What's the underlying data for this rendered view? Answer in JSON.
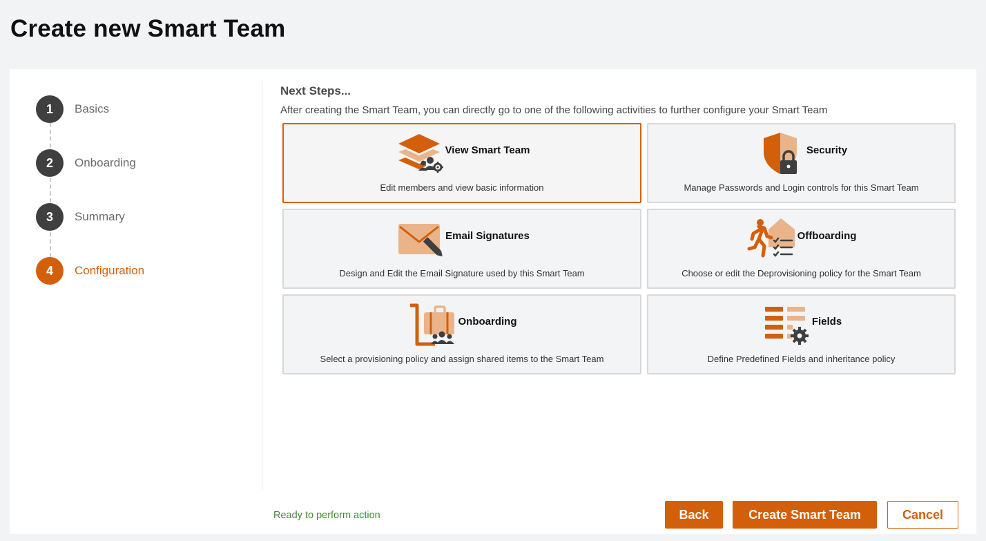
{
  "page": {
    "title": "Create new Smart Team"
  },
  "stepper": {
    "steps": [
      {
        "number": "1",
        "label": "Basics"
      },
      {
        "number": "2",
        "label": "Onboarding"
      },
      {
        "number": "3",
        "label": "Summary"
      },
      {
        "number": "4",
        "label": "Configuration",
        "active": true
      }
    ]
  },
  "next_steps": {
    "title": "Next Steps...",
    "description": "After creating the Smart Team, you can directly go to one of the following activities to further configure your Smart Team",
    "tiles": [
      {
        "title": "View Smart Team",
        "description": "Edit members and view basic information",
        "icon": "layers-team-gear-icon",
        "selected": true
      },
      {
        "title": "Security",
        "description": "Manage Passwords and Login controls for this Smart Team",
        "icon": "shield-lock-icon"
      },
      {
        "title": "Email Signatures",
        "description": "Design and Edit the Email Signature used by this Smart Team",
        "icon": "envelope-pen-icon"
      },
      {
        "title": "Offboarding",
        "description": "Choose or edit the Deprovisioning policy for the Smart Team",
        "icon": "person-leaving-checklist-icon"
      },
      {
        "title": "Onboarding",
        "description": "Select a provisioning policy and assign shared items to the Smart Team",
        "icon": "luggage-cart-team-icon"
      },
      {
        "title": "Fields",
        "description": "Define Predefined Fields and inheritance policy",
        "icon": "fields-list-gear-icon"
      }
    ]
  },
  "footer": {
    "status": "Ready to perform action",
    "back_label": "Back",
    "create_label": "Create Smart Team",
    "cancel_label": "Cancel"
  },
  "colors": {
    "accent": "#d35f0a",
    "accent_light": "#eab48a",
    "dark": "#3f3f3f",
    "status_green": "#3d8a2e"
  }
}
